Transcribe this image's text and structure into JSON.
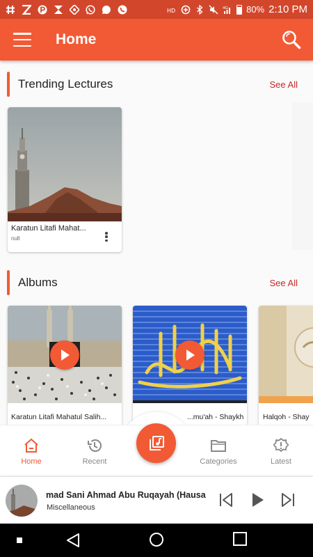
{
  "status_bar": {
    "battery": "80%",
    "time": "2:10 PM",
    "network": "4G"
  },
  "app_bar": {
    "title": "Home",
    "menu_icon": "hamburger-menu-icon",
    "search_icon": "search-icon"
  },
  "trending": {
    "title": "Trending Lectures",
    "see_all": "See All",
    "items": [
      {
        "title": "Karatun Litafi Mahat...",
        "subtitle": "null"
      }
    ]
  },
  "albums": {
    "title": "Albums",
    "see_all": "See All",
    "items": [
      {
        "title": "Karatun Litafi Mahatul Salih..."
      },
      {
        "title": "...mu'ah - Shaykh ..."
      },
      {
        "title": "Halqoh - Shay"
      }
    ]
  },
  "bottom_nav": {
    "items": [
      {
        "label": "Home",
        "icon": "home-icon",
        "active": true
      },
      {
        "label": "Recent",
        "icon": "history-icon",
        "active": false
      },
      {
        "label": "Categories",
        "icon": "folder-icon",
        "active": false
      },
      {
        "label": "Latest",
        "icon": "alert-badge-icon",
        "active": false
      }
    ],
    "fab_icon": "library-music-icon"
  },
  "now_playing": {
    "title": "mad Sani Ahmad Abu Ruqayah (Hausa",
    "subtitle": "Miscellaneous"
  },
  "colors": {
    "accent": "#f15a35",
    "status_bar": "#d2472c",
    "see_all": "#c62828"
  }
}
